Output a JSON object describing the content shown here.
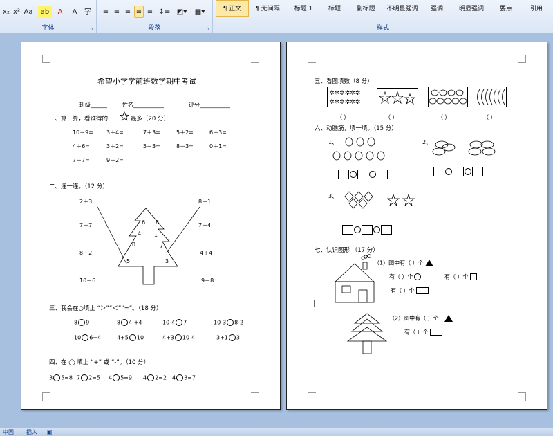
{
  "ribbon": {
    "font_group_label": "字体",
    "paragraph_group_label": "段落",
    "styles_group_label": "样式",
    "font_buttons": [
      "x₂",
      "x²",
      "Aa",
      "字"
    ],
    "styles": [
      "¶ 正文",
      "¶ 无间隔",
      "标题 1",
      "标题",
      "副标题",
      "不明显强调",
      "强调",
      "明显强调",
      "要点",
      "引用"
    ]
  },
  "left_page": {
    "title": "希望小学学前班数学期中考试",
    "info": {
      "class_label": "班级______",
      "name_label": "姓名___________",
      "score_label": "评分___________"
    },
    "s1": {
      "heading_a": "一、算一算，看谁得的",
      "heading_b": "最多（20 分）",
      "rows": [
        [
          "10－9=",
          "3＋4=",
          "7＋3=",
          "5＋2=",
          "6－3="
        ],
        [
          "4＋6=",
          "3＋2=",
          "5－3=",
          "8－3=",
          "0＋1="
        ],
        [
          "7－7=",
          "9－2="
        ]
      ]
    },
    "s2": {
      "heading": "二、连一连。（12 分）",
      "left": [
        "2＋3",
        "7－7",
        "8－2",
        "10－6"
      ],
      "right": [
        "8－1",
        "7－4",
        "4＋4",
        "9－8"
      ],
      "tree": [
        "6",
        "8",
        "4",
        "1",
        "0",
        "7",
        "5",
        "3"
      ]
    },
    "s3": {
      "heading": "三、我会在○填上 “＞”“＜”“=”。（18 分）",
      "rows": [
        [
          [
            "8",
            "9"
          ],
          [
            "8",
            "4 +4"
          ],
          [
            "10-4",
            "7"
          ],
          [
            "10-3",
            "8-2"
          ]
        ],
        [
          [
            "10",
            "6+4"
          ],
          [
            "4+5",
            "10"
          ],
          [
            "4+3",
            "10-4"
          ],
          [
            "3+1",
            "3"
          ]
        ]
      ]
    },
    "s4": {
      "heading": "四、在 ◯ 填上 “+” 或 “-”。（10 分）",
      "items": [
        [
          "3",
          "5=8"
        ],
        [
          "7",
          "2=5"
        ],
        [
          "4",
          "5=9"
        ],
        [
          "4",
          "2=2"
        ],
        [
          "4",
          "3=7"
        ]
      ]
    }
  },
  "right_page": {
    "s5": {
      "heading": "五、看图填数（8 分）",
      "blank": "（    ）"
    },
    "s6": {
      "heading": "六、动脑筋，填一填。（15 分）",
      "labels": [
        "1、",
        "2、",
        "3、"
      ]
    },
    "s7": {
      "heading": "七、认识图形 （17 分）",
      "q1_line1": "（1）图中有（   ）个",
      "q1_line2a": "有（   ）个",
      "q1_line2b": "有（   ）个",
      "q1_line3": "有（   ）个",
      "q2_line1": "（2）图中有（   ）个",
      "q2_line2": "有（   ）个"
    }
  },
  "status": {
    "language": "中国",
    "mode": "插入"
  }
}
